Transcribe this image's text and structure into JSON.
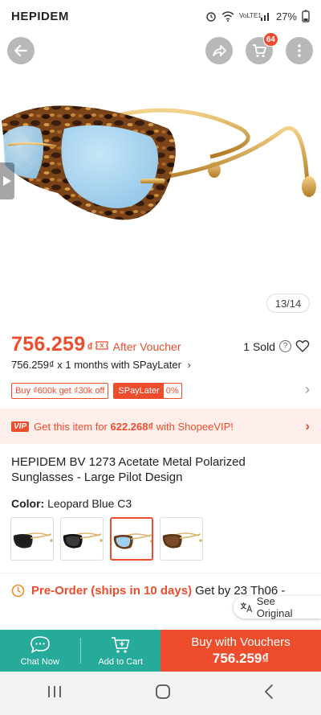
{
  "status_bar": {
    "time": "HEPIDEM",
    "network": "VoLTE1",
    "battery": "27%"
  },
  "gallery": {
    "image_counter": "13/14",
    "cart_badge": "64",
    "icons": [
      "back-arrow-icon",
      "share-icon",
      "cart-icon",
      "more-icon",
      "play-icon"
    ]
  },
  "price": {
    "amount": "756.259",
    "currency": "₫",
    "after_voucher": "After Voucher",
    "sold": "1 Sold",
    "installment": "756.259₫ x 1 months with SPayLater",
    "tag_discount": "Buy ₫600k get ₫30k off",
    "tag_spay": "SPayLater",
    "tag_spay_value": "0%"
  },
  "vip": {
    "badge": "VIP",
    "text_before": "Get this item for ",
    "vip_price": "622.268₫",
    "text_after": " with ShopeeVIP!"
  },
  "product": {
    "title": "HEPIDEM BV 1273 Acetate Metal Polarized Sunglasses - Large Pilot Design",
    "color_label": "Color:",
    "color_value": "Leopard Blue C3"
  },
  "variants": [
    {
      "name": "Black",
      "lens": "#1d1d1d",
      "frame": "#222222"
    },
    {
      "name": "Black Grey",
      "lens": "#3a3a3a",
      "frame": "#111111"
    },
    {
      "name": "Leopard Blue C3",
      "lens": "#9fd0ee",
      "frame": "#6b3b17",
      "selected": true
    },
    {
      "name": "Leopard Brown",
      "lens": "#7a4a2a",
      "frame": "#5a3518"
    }
  ],
  "shipping": {
    "preorder": "Pre-Order (ships in 10 days)",
    "get_by": "Get by 23 Th06 -"
  },
  "see_original": "See Original",
  "bottom_bar": {
    "chat": "Chat Now",
    "add_cart": "Add to Cart",
    "buy_line1": "Buy with Vouchers",
    "buy_line2": "756.259₫"
  },
  "colors": {
    "accent": "#ee4d2d",
    "teal": "#26aa99",
    "vip_bg": "#fdeee9"
  }
}
